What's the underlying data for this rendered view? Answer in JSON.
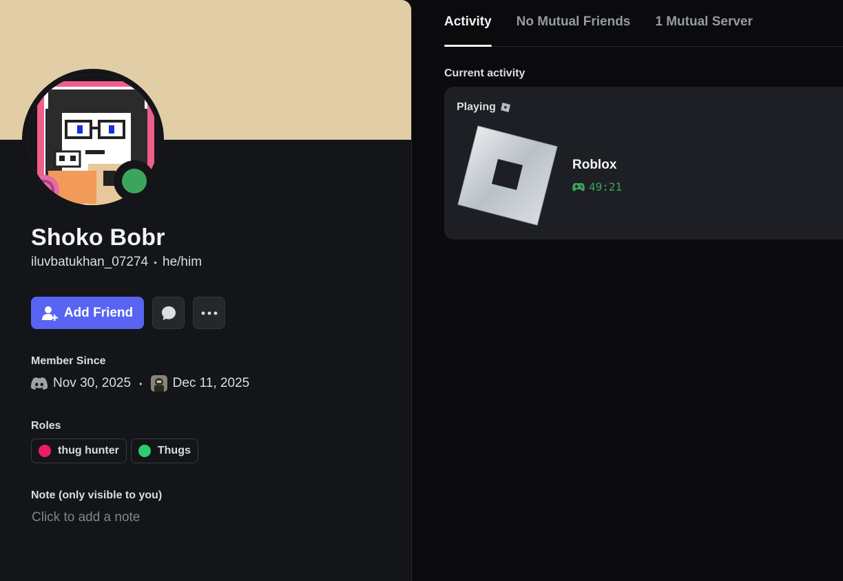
{
  "profile": {
    "display_name": "Shoko Bobr",
    "username": "iluvbatukhan_07274",
    "separator": "•",
    "pronouns": "he/him",
    "status": "online",
    "banner_color": "#e1cea6"
  },
  "actions": {
    "add_friend_label": "Add Friend",
    "message_icon": "chat-bubble-icon",
    "more_icon": "ellipsis-icon"
  },
  "member_since": {
    "label": "Member Since",
    "discord_date": "Nov 30, 2025",
    "separator": "•",
    "server_date": "Dec 11, 2025"
  },
  "roles": {
    "label": "Roles",
    "items": [
      {
        "name": "thug hunter",
        "color": "#e91e63"
      },
      {
        "name": "Thugs",
        "color": "#2ecc71"
      }
    ]
  },
  "note": {
    "label": "Note (only visible to you)",
    "placeholder": "Click to add a note"
  },
  "tabs": [
    {
      "label": "Activity",
      "active": true
    },
    {
      "label": "No Mutual Friends",
      "active": false
    },
    {
      "label": "1 Mutual Server",
      "active": false
    }
  ],
  "activity": {
    "section_label": "Current activity",
    "type_label": "Playing",
    "game_name": "Roblox",
    "elapsed": "49:21"
  }
}
